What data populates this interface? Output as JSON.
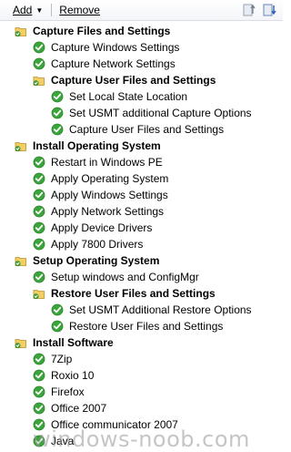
{
  "toolbar": {
    "add_label": "Add",
    "remove_label": "Remove"
  },
  "tree": {
    "g1": "Capture Files and Settings",
    "g1_items": [
      "Capture Windows Settings",
      "Capture Network Settings"
    ],
    "g1a": "Capture User Files and Settings",
    "g1a_items": [
      "Set Local State Location",
      "Set USMT additional Capture Options",
      "Capture User Files and Settings"
    ],
    "g2": "Install Operating System",
    "g2_items": [
      "Restart in Windows PE",
      "Apply Operating System",
      "Apply Windows Settings",
      "Apply Network Settings",
      "Apply Device Drivers",
      "Apply 7800 Drivers"
    ],
    "g3": "Setup Operating System",
    "g3_items": [
      "Setup windows and ConfigMgr"
    ],
    "g3a": "Restore User Files and Settings",
    "g3a_items": [
      "Set USMT Additional Restore Options",
      "Restore User Files and Settings"
    ],
    "g4": "Install Software",
    "g4_items": [
      "7Zip",
      "Roxio 10",
      "Firefox",
      "Office 2007",
      "Office communicator 2007",
      "Java"
    ]
  },
  "watermark": "windows-noob.com",
  "colors": {
    "check_green": "#3aa53a",
    "folder_yellow": "#f3cf62"
  }
}
